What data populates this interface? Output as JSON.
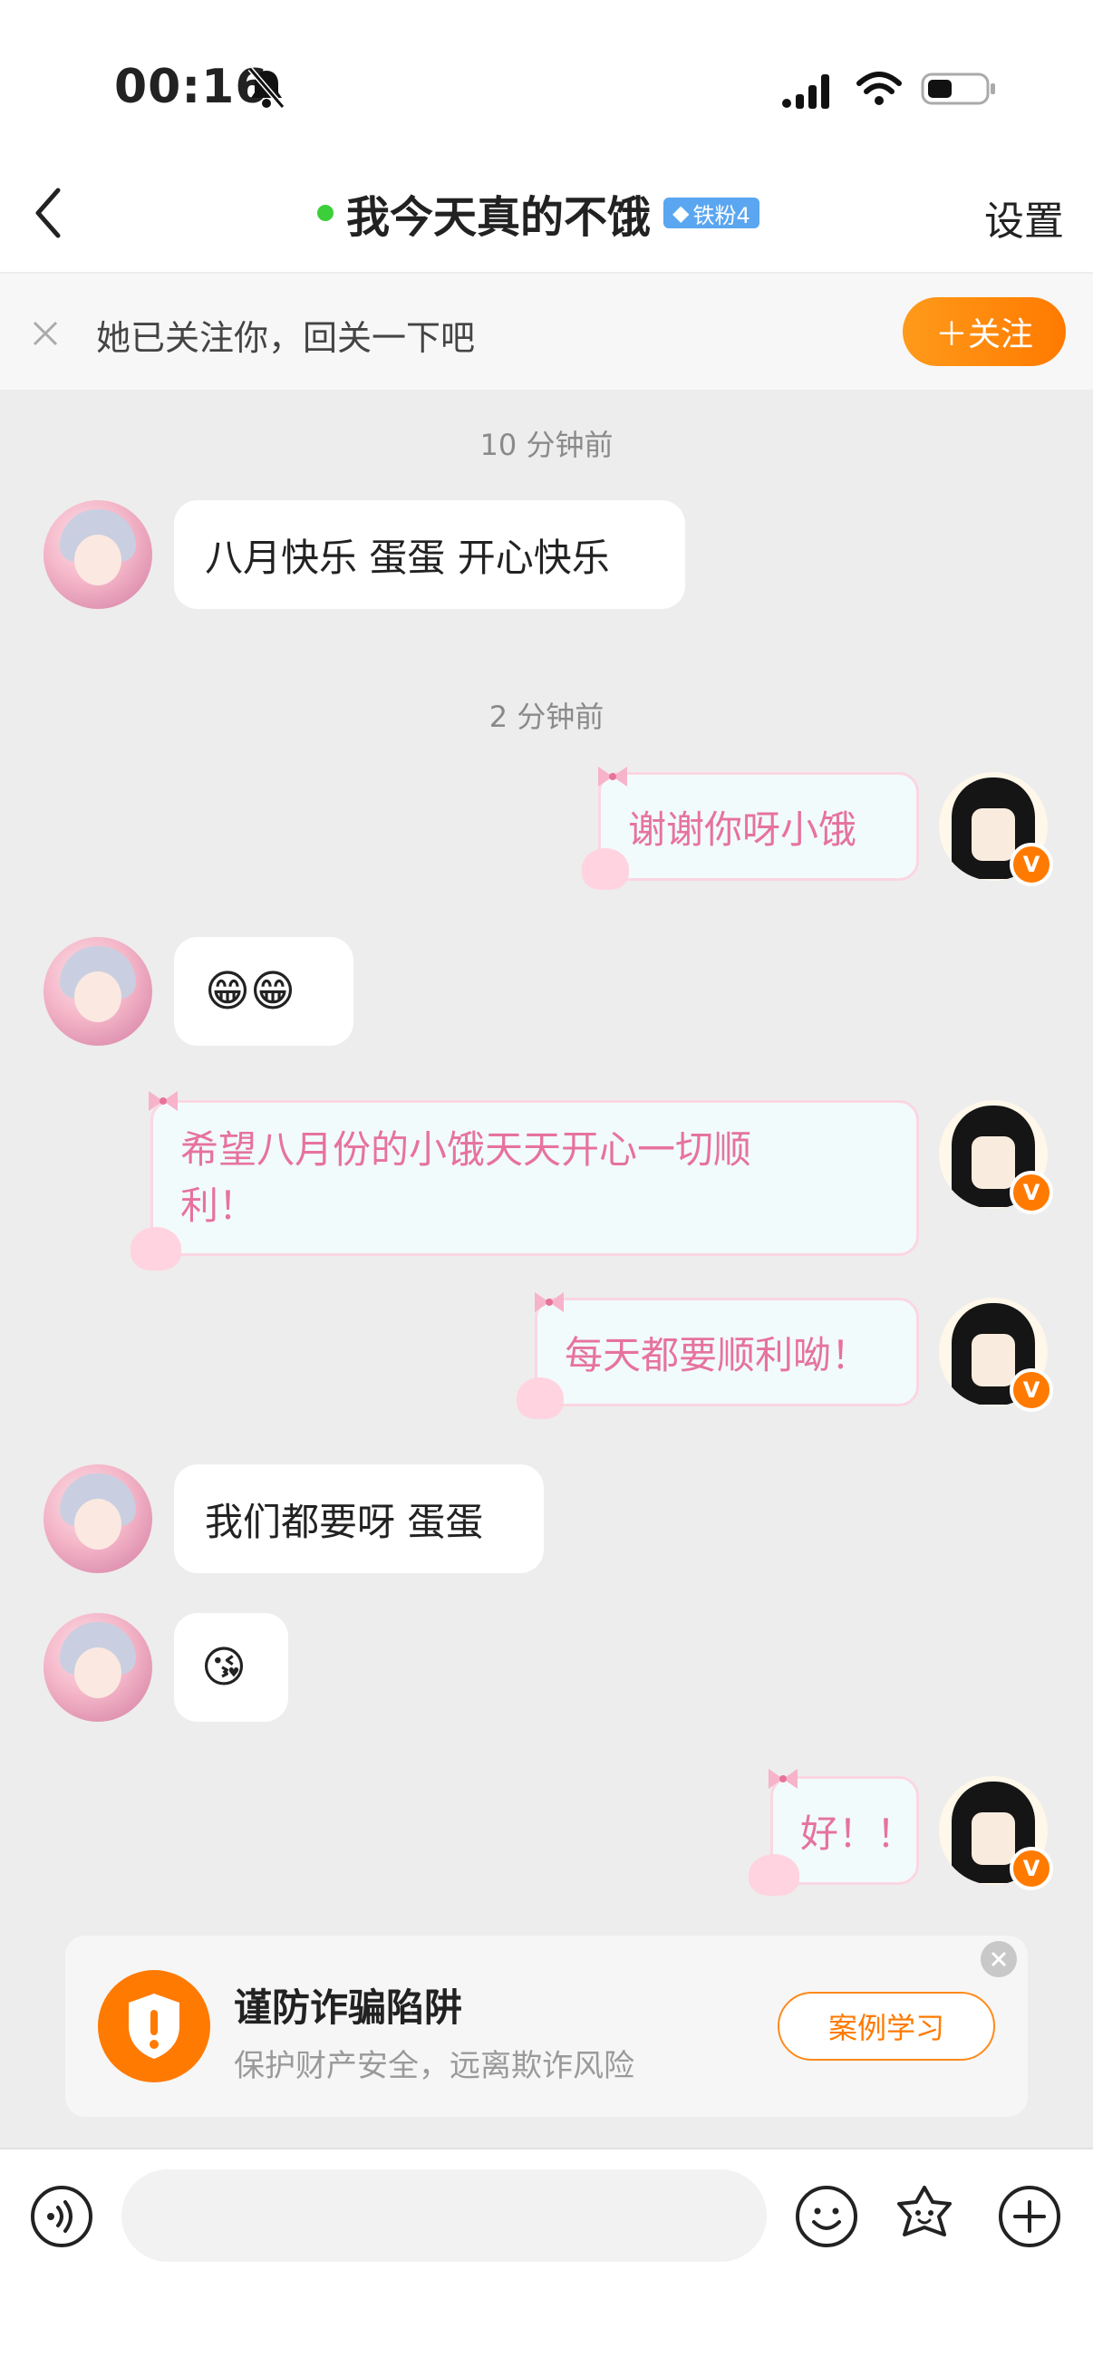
{
  "status_bar": {
    "time": "00:16",
    "icons": [
      "bell-slash-icon",
      "signal-icon",
      "wifi-icon",
      "battery-icon"
    ]
  },
  "header": {
    "title": "我今天真的不饿",
    "badge": "铁粉4",
    "settings_label": "设置",
    "online_color": "#3ccf3a"
  },
  "follow_bar": {
    "text": "她已关注你，回关一下吧",
    "button_label": "＋关注"
  },
  "messages": {
    "ts1": "10 分钟前",
    "m1": "八月快乐 蛋蛋 开心快乐",
    "ts2": "2 分钟前",
    "m2": "谢谢你呀小饿",
    "m3": "😁😁",
    "m4_line1": "希望八月份的小饿天天开心一切顺",
    "m4_line2": "利！",
    "m5": "每天都要顺利呦！",
    "m6": "我们都要呀 蛋蛋",
    "m7": "😘",
    "m8": "好！！"
  },
  "fraud_card": {
    "title": "谨防诈骗陷阱",
    "subtitle": "保护财产安全，远离欺诈风险",
    "button_label": "案例学习"
  },
  "input": {
    "placeholder": ""
  },
  "colors": {
    "accent": "#ff7a00",
    "bubble_right_text": "#e6739c",
    "bubble_right_border": "#fbd6e2"
  }
}
